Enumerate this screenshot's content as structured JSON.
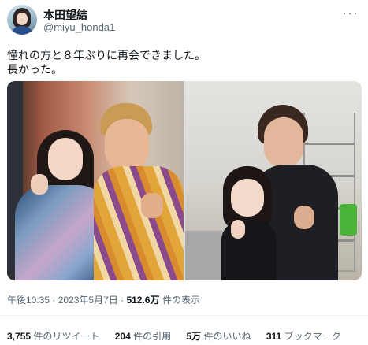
{
  "user": {
    "display_name": "本田望結",
    "handle": "@miyu_honda1"
  },
  "tweet": {
    "text": "憧れの方と８年ぶりに再会できました。\n長かった。"
  },
  "meta": {
    "time": "午後10:35",
    "dot1": "·",
    "date": "2023年5月7日",
    "dot2": "·",
    "views": "512.6万",
    "views_label": "件の表示"
  },
  "stats": [
    {
      "count": "3,755",
      "label": "件のリツイート"
    },
    {
      "count": "204",
      "label": "件の引用"
    },
    {
      "count": "5万",
      "label": "件のいいね"
    },
    {
      "count": "311",
      "label": "ブックマーク"
    }
  ],
  "icons": {
    "more": "more-icon"
  }
}
